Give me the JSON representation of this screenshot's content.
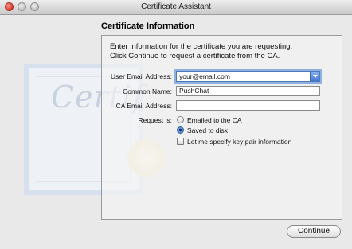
{
  "window": {
    "title": "Certificate Assistant"
  },
  "section": {
    "title": "Certificate Information"
  },
  "background": {
    "cert_word": "Certif"
  },
  "description": {
    "line1": "Enter information for the certificate you are requesting.",
    "line2": "Click Continue to request a certificate from the CA."
  },
  "form": {
    "user_email": {
      "label": "User Email Address:",
      "value": "your@email.com"
    },
    "common_name": {
      "label": "Common Name:",
      "value": "PushChat"
    },
    "ca_email": {
      "label": "CA Email Address:",
      "value": ""
    },
    "request_is": {
      "label": "Request is:",
      "options": [
        {
          "label": "Emailed to the CA",
          "selected": false
        },
        {
          "label": "Saved to disk",
          "selected": true
        }
      ]
    },
    "key_pair": {
      "label": "Let me specify key pair information",
      "checked": false
    }
  },
  "buttons": {
    "continue": "Continue"
  }
}
